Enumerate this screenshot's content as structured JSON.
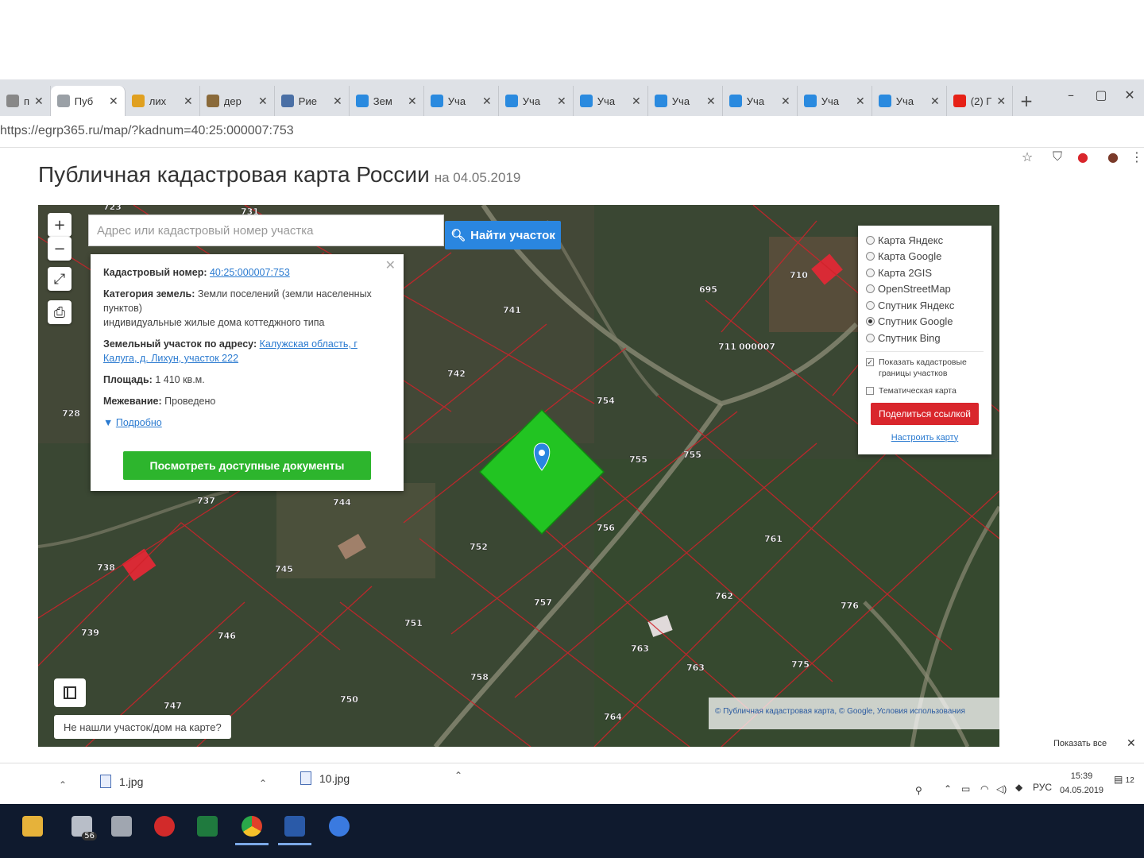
{
  "browser": {
    "tabs": [
      {
        "label": "п",
        "icon_color": "#888888",
        "active": false
      },
      {
        "label": "Пуб",
        "icon_color": "#9aa0a6",
        "active": true
      },
      {
        "label": "лих",
        "icon_color": "#e0a020",
        "active": false
      },
      {
        "label": "дер",
        "icon_color": "#8a6a3a",
        "active": false
      },
      {
        "label": "Рие",
        "icon_color": "#4a6fa5",
        "active": false
      },
      {
        "label": "Зем",
        "icon_color": "#2a8adf",
        "active": false
      },
      {
        "label": "Уча",
        "icon_color": "#2a8adf",
        "active": false
      },
      {
        "label": "Уча",
        "icon_color": "#2a8adf",
        "active": false
      },
      {
        "label": "Уча",
        "icon_color": "#2a8adf",
        "active": false
      },
      {
        "label": "Уча",
        "icon_color": "#2a8adf",
        "active": false
      },
      {
        "label": "Уча",
        "icon_color": "#2a8adf",
        "active": false
      },
      {
        "label": "Уча",
        "icon_color": "#2a8adf",
        "active": false
      },
      {
        "label": "Уча",
        "icon_color": "#2a8adf",
        "active": false
      },
      {
        "label": "(2) Г",
        "icon_color": "#e62117",
        "active": false
      }
    ],
    "url": "https://egrp365.ru/map/?kadnum=40:25:000007:753"
  },
  "page": {
    "title": "Публичная кадастровая карта России",
    "date": "на 04.05.2019"
  },
  "map": {
    "search_placeholder": "Адрес или кадастровый номер участка",
    "search_button": "Найти участок",
    "info": {
      "cadastral_key": "Кадастровый номер:",
      "cadastral_value": "40:25:000007:753",
      "category_key": "Категория земель:",
      "category_value": "Земли поселений (земли населенных пунктов)",
      "category_use": "индивидуальные жилые дома коттеджного типа",
      "address_key": "Земельный участок по адресу:",
      "address_value": "Калужская область, г Калуга, д. Лихун, участок 222",
      "area_key": "Площадь:",
      "area_value": "1 410 кв.м.",
      "survey_key": "Межевание:",
      "survey_value": "Проведено",
      "more": "Подробно",
      "docs_button": "Посмотреть доступные документы"
    },
    "layers": [
      {
        "label": "Карта Яндекс",
        "selected": false
      },
      {
        "label": "Карта Google",
        "selected": false
      },
      {
        "label": "Карта 2GIS",
        "selected": false
      },
      {
        "label": "OpenStreetMap",
        "selected": false
      },
      {
        "label": "Спутник Яндекс",
        "selected": false
      },
      {
        "label": "Спутник Google",
        "selected": true
      },
      {
        "label": "Спутник Bing",
        "selected": false
      }
    ],
    "show_borders": "Показать кадастровые границы участков",
    "thematic": "Тематическая карта",
    "share_button": "Поделиться ссылкой",
    "configure_link": "Настроить карту",
    "not_found": "Не нашли участок/дом на карте?",
    "attribution": "© Публичная кадастровая карта, © Google, Условия использования",
    "parcel_labels": [
      "723",
      "731",
      "741",
      "742",
      "695",
      "710",
      "711",
      "000007",
      "754",
      "755",
      "755",
      "756",
      "752",
      "757",
      "737",
      "744",
      "745",
      "738",
      "739",
      "746",
      "751",
      "758",
      "750",
      "747",
      "728",
      "761",
      "762",
      "763",
      "763",
      "764",
      "776",
      "775"
    ]
  },
  "downloads": {
    "items": [
      {
        "name": "1.jpg"
      },
      {
        "name": "10.jpg"
      }
    ],
    "show_all": "Показать все"
  },
  "system": {
    "lang": "РУС",
    "time": "15:39",
    "date": "04.05.2019",
    "mail_badge": "56",
    "notif_badge": "12"
  },
  "colors": {
    "accent_blue": "#2a86e0",
    "doc_green": "#2db52d",
    "share_red": "#d9262c",
    "parcel_fill": "#22c422",
    "boundary_red": "#d0222a"
  }
}
